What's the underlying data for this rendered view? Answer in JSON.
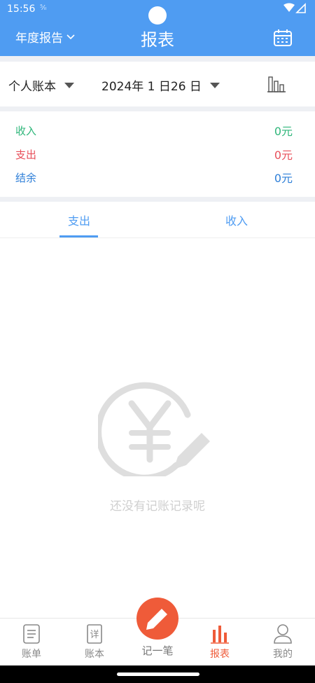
{
  "status": {
    "time": "15:56",
    "sim": "⁵⁄ᵢₗ"
  },
  "header": {
    "period_label": "年度报告",
    "title": "报表"
  },
  "filter": {
    "book": "个人账本",
    "date": "2024年 1 日26 日"
  },
  "summary": {
    "income_label": "收入",
    "income_value": "0元",
    "income_color": "#2fb67a",
    "expense_label": "支出",
    "expense_value": "0元",
    "expense_color": "#e8505b",
    "balance_label": "结余",
    "balance_value": "0元",
    "balance_color": "#2e7fd8"
  },
  "tabs": [
    {
      "label": "支出",
      "active": true
    },
    {
      "label": "收入",
      "active": false
    }
  ],
  "empty": {
    "message": "还没有记账记录呢"
  },
  "nav": {
    "items": [
      {
        "label": "账单",
        "icon": "bill-icon"
      },
      {
        "label": "账本",
        "icon": "ledger-icon"
      },
      {
        "label": "报表",
        "icon": "report-chart-icon",
        "active": true
      },
      {
        "label": "我的",
        "icon": "profile-icon"
      }
    ],
    "fab_label": "记一笔",
    "accent": "#ef5b39"
  },
  "theme": {
    "primary": "#4f9cf2"
  }
}
